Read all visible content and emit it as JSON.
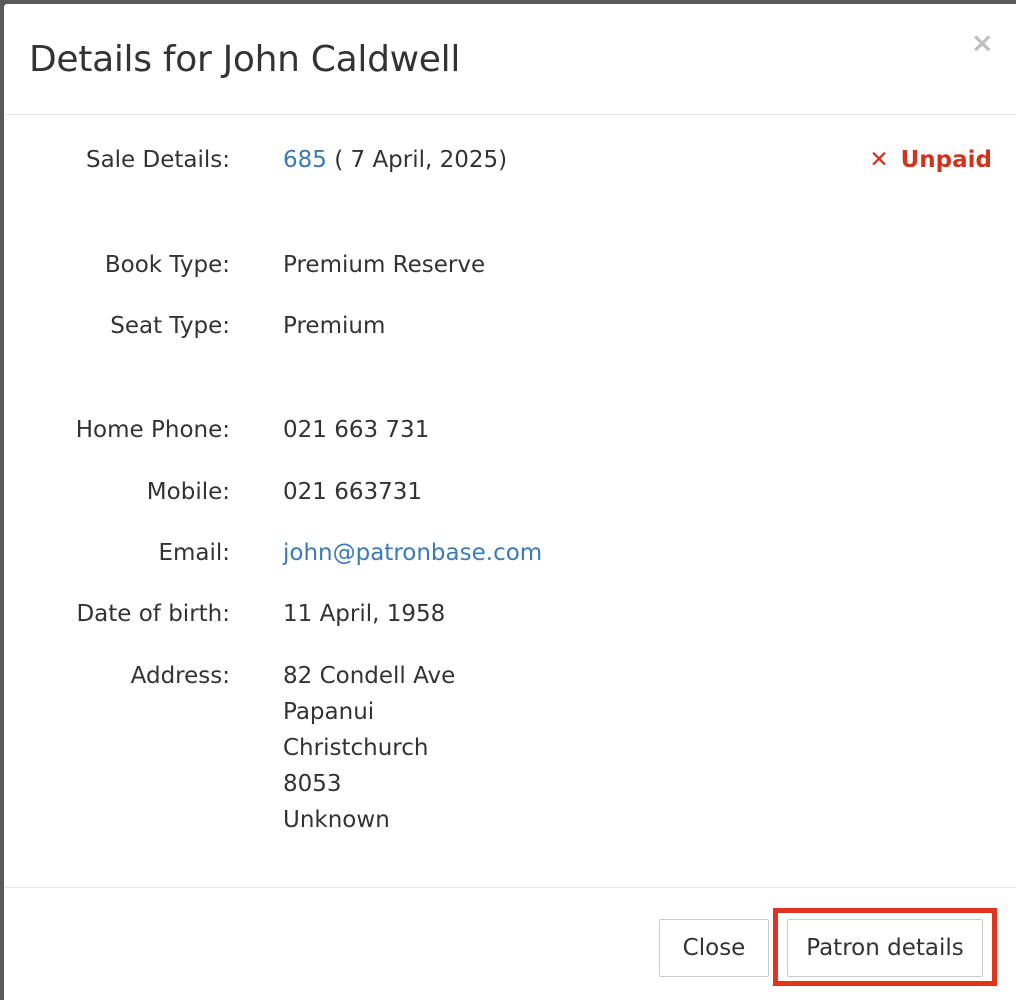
{
  "modal": {
    "title": "Details for John Caldwell",
    "close_symbol": "×"
  },
  "sale": {
    "label": "Sale Details:",
    "id": "685",
    "date": " ( 7 April, 2025)",
    "status_icon": "✕",
    "status": "Unpaid"
  },
  "book": {
    "type_label": "Book Type:",
    "type_value": "Premium Reserve",
    "seat_label": "Seat Type:",
    "seat_value": "Premium"
  },
  "contact": {
    "home_phone_label": "Home Phone:",
    "home_phone": "021 663 731",
    "mobile_label": "Mobile:",
    "mobile": "021 663731",
    "email_label": "Email:",
    "email": "john@patronbase.com",
    "dob_label": "Date of birth:",
    "dob": "11 April, 1958",
    "address_label": "Address:",
    "address": [
      "82 Condell Ave",
      "Papanui",
      "Christchurch",
      "8053",
      "Unknown"
    ]
  },
  "footer": {
    "close_label": "Close",
    "patron_details_label": "Patron details"
  },
  "colors": {
    "link": "#3a7ab8",
    "unpaid": "#d0341f",
    "highlight": "#e3331f"
  }
}
